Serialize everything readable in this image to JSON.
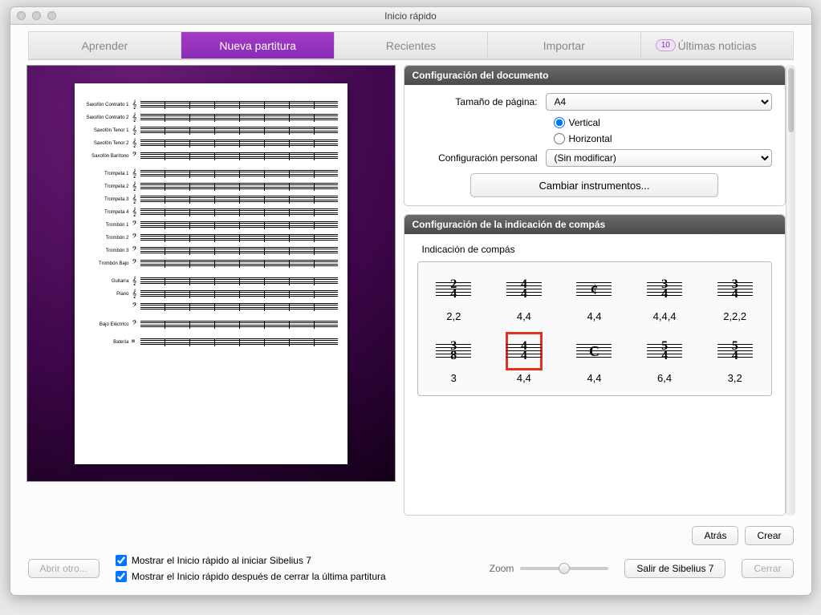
{
  "window": {
    "title": "Inicio rápido"
  },
  "tabs": [
    {
      "label": "Aprender",
      "active": false
    },
    {
      "label": "Nueva partitura",
      "active": true
    },
    {
      "label": "Recientes",
      "active": false
    },
    {
      "label": "Importar",
      "active": false
    },
    {
      "label": "Últimas noticias",
      "active": false,
      "badge": "10"
    }
  ],
  "preview": {
    "instruments": [
      {
        "name": "Saxofón Contralto 1",
        "clef": "𝄞"
      },
      {
        "name": "Saxofón Contralto 2",
        "clef": "𝄞"
      },
      {
        "name": "Saxofón Tenor 1",
        "clef": "𝄞"
      },
      {
        "name": "Saxofón Tenor 2",
        "clef": "𝄞"
      },
      {
        "name": "Saxofón Barítono",
        "clef": "𝄢"
      },
      {
        "name": "Trompeta 1",
        "clef": "𝄞",
        "gap": true
      },
      {
        "name": "Trompeta 2",
        "clef": "𝄞"
      },
      {
        "name": "Trompeta 3",
        "clef": "𝄞"
      },
      {
        "name": "Trompeta 4",
        "clef": "𝄞"
      },
      {
        "name": "Trombón 1",
        "clef": "𝄢"
      },
      {
        "name": "Trombón 2",
        "clef": "𝄢"
      },
      {
        "name": "Trombón 3",
        "clef": "𝄢"
      },
      {
        "name": "Trombón Bajo",
        "clef": "𝄢"
      },
      {
        "name": "Guitarra",
        "clef": "𝄞",
        "gap": true
      },
      {
        "name": "Piano",
        "clef": "𝄞"
      },
      {
        "name": "",
        "clef": "𝄢"
      },
      {
        "name": "Bajo Eléctrico",
        "clef": "𝄢",
        "gap": true
      },
      {
        "name": "Batería",
        "clef": "𝄥",
        "gap": true
      }
    ]
  },
  "doc_config": {
    "header": "Configuración del documento",
    "page_size_label": "Tamaño de página:",
    "page_size_value": "A4",
    "orientation_vertical": "Vertical",
    "orientation_horizontal": "Horizontal",
    "orientation_selected": "vertical",
    "personal_label": "Configuración personal",
    "personal_value": "(Sin modificar)",
    "change_instruments": "Cambiar instrumentos..."
  },
  "time_sig": {
    "header": "Configuración de la indicación de compás",
    "section_label": "Indicación de compás",
    "items": [
      {
        "top": "2",
        "bot": "4",
        "label": "2,2"
      },
      {
        "top": "4",
        "bot": "4",
        "label": "4,4"
      },
      {
        "sym": "¢",
        "label": "4,4"
      },
      {
        "top": "3",
        "bot": "4",
        "label": "4,4,4"
      },
      {
        "top": "3",
        "bot": "4",
        "label": "2,2,2"
      },
      {
        "top": "3",
        "bot": "8",
        "label": "3"
      },
      {
        "top": "4",
        "bot": "4",
        "label": "4,4",
        "selected": true
      },
      {
        "sym": "C",
        "label": "4,4"
      },
      {
        "top": "5",
        "bot": "4",
        "label": "6,4"
      },
      {
        "top": "5",
        "bot": "4",
        "label": "3,2"
      }
    ]
  },
  "nav_buttons": {
    "back": "Atrás",
    "create": "Crear"
  },
  "footer": {
    "open_other": "Abrir otro...",
    "check1": "Mostrar el Inicio rápido al iniciar Sibelius 7",
    "check2": "Mostrar el Inicio rápido después de cerrar la última partitura",
    "zoom_label": "Zoom",
    "exit": "Salir de Sibelius 7",
    "close": "Cerrar"
  }
}
